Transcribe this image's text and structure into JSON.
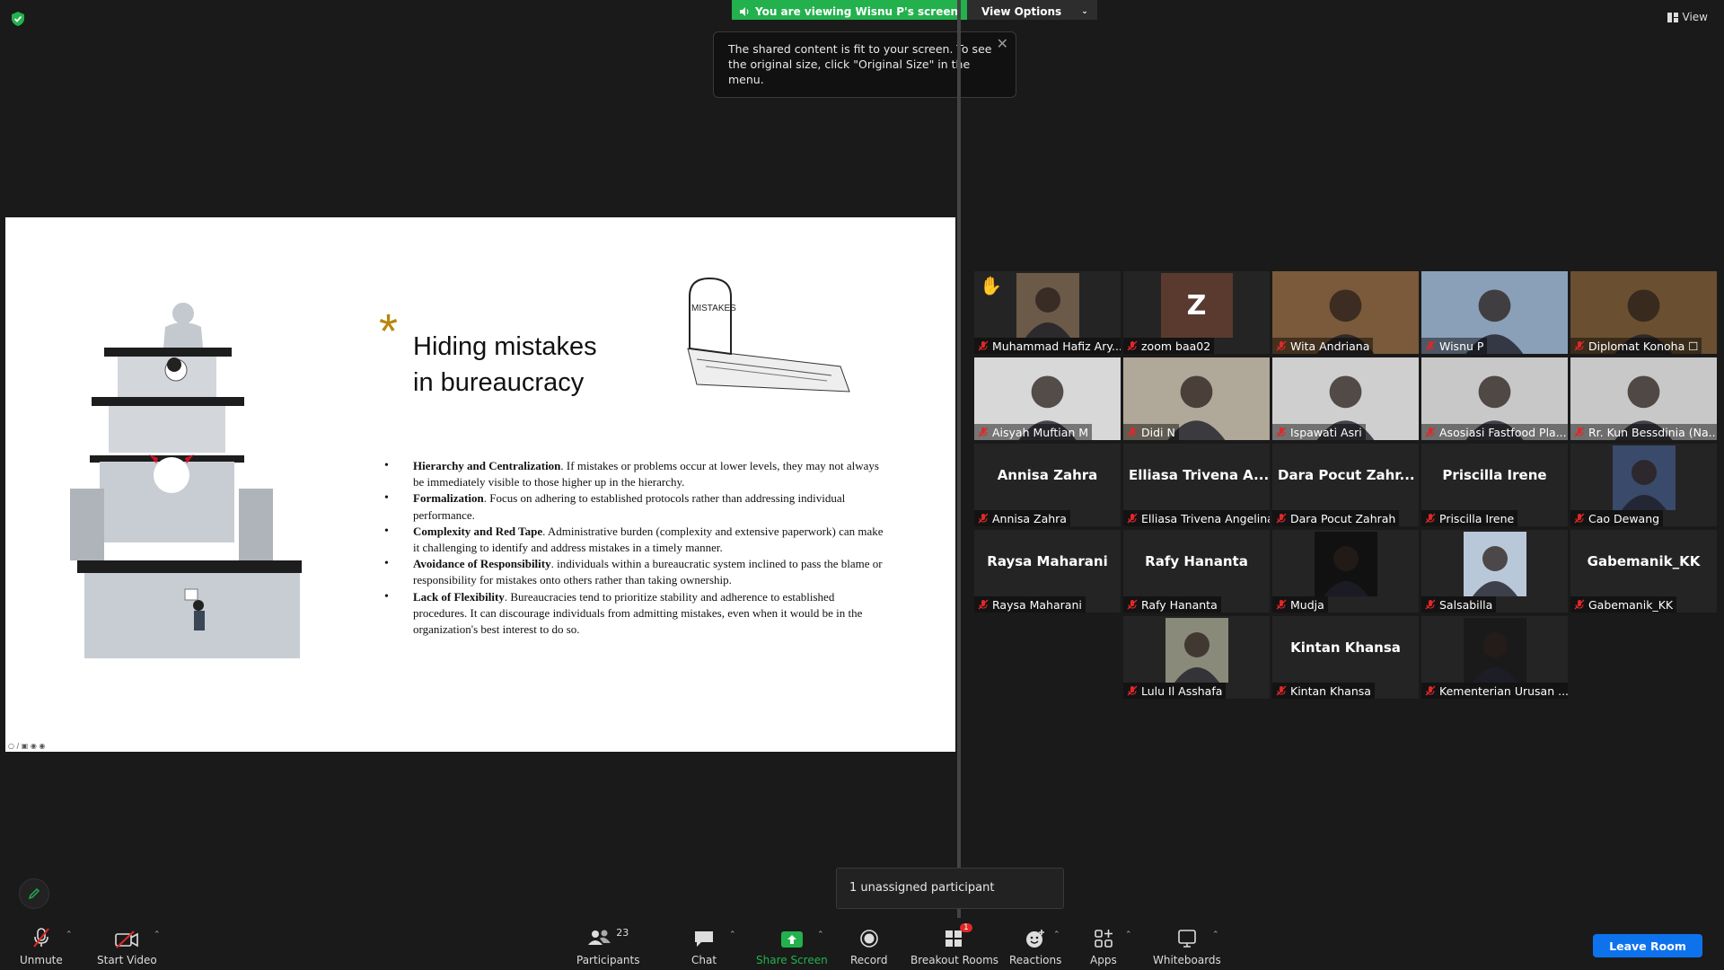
{
  "banner": {
    "viewing": "You are viewing Wisnu P's screen",
    "options": "View Options"
  },
  "tooltip": {
    "text": "The shared content is fit to your screen. To see the original size, click \"Original Size\" in the menu."
  },
  "view_label": "View",
  "slide": {
    "title_line1": "Hiding mistakes",
    "title_line2": "in bureaucracy",
    "tombstone": "MISTAKES",
    "bullets": [
      {
        "head": "Hierarchy and Centralization",
        "text": ". If mistakes or problems occur at lower levels, they may not always be immediately visible to those higher up in the hierarchy."
      },
      {
        "head": "Formalization",
        "text": ". Focus on adhering to established protocols rather than addressing individual performance."
      },
      {
        "head": "Complexity and Red Tape",
        "text": ". Administrative burden (complexity and extensive paperwork) can make it challenging to identify and address mistakes in a timely manner."
      },
      {
        "head": "Avoidance of Responsibility",
        "text": ". individuals within a bureaucratic system inclined to pass the blame or responsibility for mistakes onto others rather than taking ownership."
      },
      {
        "head": "Lack of Flexibility",
        "text": ". Bureaucracies tend to prioritize stability and adherence to established procedures. It can discourage individuals from admitting mistakes, even when it would be in the organization's best interest to do so."
      }
    ]
  },
  "participants": [
    {
      "name": "Muhammad Hafiz Ary...",
      "kind": "photo",
      "hand": true
    },
    {
      "name": "zoom baa02",
      "kind": "initial",
      "initial": "Z"
    },
    {
      "name": "Wita Andriana",
      "kind": "photo",
      "active": true
    },
    {
      "name": "Wisnu P",
      "kind": "photo"
    },
    {
      "name": "Diplomat Konoha ☐",
      "kind": "photo"
    },
    {
      "name": "Aisyah Muftian M",
      "kind": "photo"
    },
    {
      "name": "Didi N",
      "kind": "photo"
    },
    {
      "name": "Ispawati Asri",
      "kind": "photo"
    },
    {
      "name": "Asosiasi Fastfood Pla...",
      "kind": "photo"
    },
    {
      "name": "Rr. Kun Bessdinia (Na...",
      "kind": "photo"
    },
    {
      "name": "Annisa Zahra",
      "big": "Annisa Zahra",
      "kind": "text"
    },
    {
      "name": "Elliasa Trivena Angelina",
      "big": "Elliasa Trivena A...",
      "kind": "text"
    },
    {
      "name": "Dara Pocut Zahrah",
      "big": "Dara Pocut Zahr...",
      "kind": "text"
    },
    {
      "name": "Priscilla Irene",
      "big": "Priscilla Irene",
      "kind": "text"
    },
    {
      "name": "Cao Dewang",
      "kind": "photo"
    },
    {
      "name": "Raysa Maharani",
      "big": "Raysa Maharani",
      "kind": "text"
    },
    {
      "name": "Rafy Hananta",
      "big": "Rafy Hananta",
      "kind": "text"
    },
    {
      "name": "Mudja",
      "kind": "photo"
    },
    {
      "name": "Salsabilla",
      "kind": "photo"
    },
    {
      "name": "Gabemanik_KK",
      "big": "Gabemanik_KK",
      "kind": "text"
    },
    {
      "name": "Lulu Il Asshafa",
      "kind": "photo"
    },
    {
      "name": "Kintan Khansa",
      "big": "Kintan Khansa",
      "kind": "text"
    },
    {
      "name": "Kementerian Urusan ...",
      "kind": "photo"
    }
  ],
  "breakout_popup": "1 unassigned participant",
  "toolbar": {
    "unmute": "Unmute",
    "start_video": "Start Video",
    "participants": "Participants",
    "participants_count": "23",
    "chat": "Chat",
    "share_screen": "Share Screen",
    "record": "Record",
    "breakout_rooms": "Breakout Rooms",
    "breakout_badge": "1",
    "reactions": "Reactions",
    "apps": "Apps",
    "whiteboards": "Whiteboards",
    "leave": "Leave Room"
  },
  "colors": {
    "green": "#23b14d",
    "leave": "#0e72ed",
    "active_border": "#e8e26a",
    "mute_red": "#e02828"
  }
}
